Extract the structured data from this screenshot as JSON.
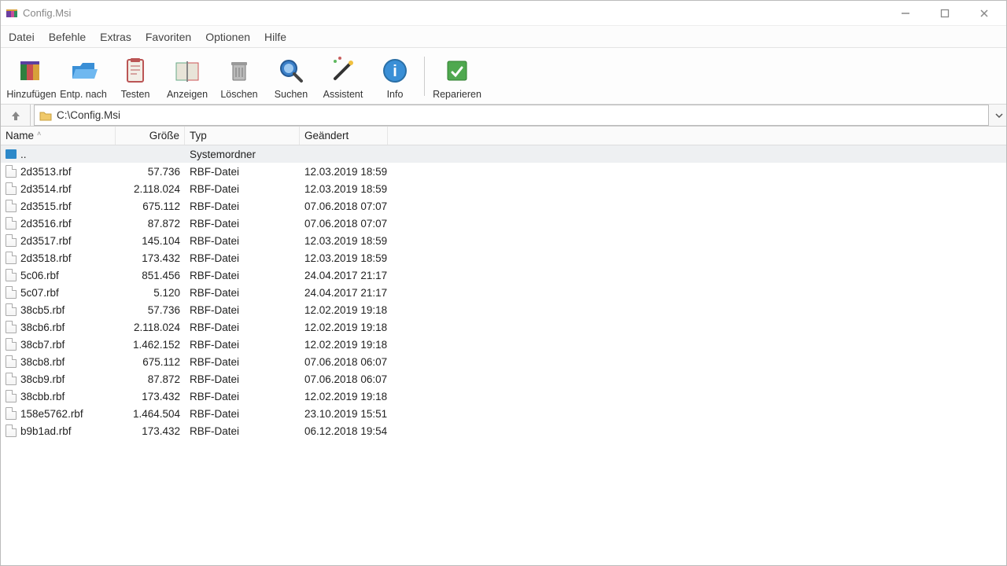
{
  "window": {
    "title": "Config.Msi"
  },
  "menu": {
    "items": [
      "Datei",
      "Befehle",
      "Extras",
      "Favoriten",
      "Optionen",
      "Hilfe"
    ]
  },
  "toolbar": {
    "items": [
      {
        "label": "Hinzufügen",
        "icon": "add"
      },
      {
        "label": "Entp. nach",
        "icon": "extract"
      },
      {
        "label": "Testen",
        "icon": "test"
      },
      {
        "label": "Anzeigen",
        "icon": "view"
      },
      {
        "label": "Löschen",
        "icon": "delete"
      },
      {
        "label": "Suchen",
        "icon": "search"
      },
      {
        "label": "Assistent",
        "icon": "wizard"
      },
      {
        "label": "Info",
        "icon": "info"
      }
    ],
    "after_sep": [
      {
        "label": "Reparieren",
        "icon": "repair"
      }
    ]
  },
  "path": "C:\\Config.Msi",
  "columns": {
    "name": "Name",
    "size": "Größe",
    "type": "Typ",
    "modified": "Geändert"
  },
  "updir": {
    "name": "..",
    "type": "Systemordner"
  },
  "files": [
    {
      "name": "2d3513.rbf",
      "size": "57.736",
      "type": "RBF-Datei",
      "mod": "12.03.2019 18:59"
    },
    {
      "name": "2d3514.rbf",
      "size": "2.118.024",
      "type": "RBF-Datei",
      "mod": "12.03.2019 18:59"
    },
    {
      "name": "2d3515.rbf",
      "size": "675.112",
      "type": "RBF-Datei",
      "mod": "07.06.2018 07:07"
    },
    {
      "name": "2d3516.rbf",
      "size": "87.872",
      "type": "RBF-Datei",
      "mod": "07.06.2018 07:07"
    },
    {
      "name": "2d3517.rbf",
      "size": "145.104",
      "type": "RBF-Datei",
      "mod": "12.03.2019 18:59"
    },
    {
      "name": "2d3518.rbf",
      "size": "173.432",
      "type": "RBF-Datei",
      "mod": "12.03.2019 18:59"
    },
    {
      "name": "5c06.rbf",
      "size": "851.456",
      "type": "RBF-Datei",
      "mod": "24.04.2017 21:17"
    },
    {
      "name": "5c07.rbf",
      "size": "5.120",
      "type": "RBF-Datei",
      "mod": "24.04.2017 21:17"
    },
    {
      "name": "38cb5.rbf",
      "size": "57.736",
      "type": "RBF-Datei",
      "mod": "12.02.2019 19:18"
    },
    {
      "name": "38cb6.rbf",
      "size": "2.118.024",
      "type": "RBF-Datei",
      "mod": "12.02.2019 19:18"
    },
    {
      "name": "38cb7.rbf",
      "size": "1.462.152",
      "type": "RBF-Datei",
      "mod": "12.02.2019 19:18"
    },
    {
      "name": "38cb8.rbf",
      "size": "675.112",
      "type": "RBF-Datei",
      "mod": "07.06.2018 06:07"
    },
    {
      "name": "38cb9.rbf",
      "size": "87.872",
      "type": "RBF-Datei",
      "mod": "07.06.2018 06:07"
    },
    {
      "name": "38cbb.rbf",
      "size": "173.432",
      "type": "RBF-Datei",
      "mod": "12.02.2019 19:18"
    },
    {
      "name": "158e5762.rbf",
      "size": "1.464.504",
      "type": "RBF-Datei",
      "mod": "23.10.2019 15:51"
    },
    {
      "name": "b9b1ad.rbf",
      "size": "173.432",
      "type": "RBF-Datei",
      "mod": "06.12.2018 19:54"
    }
  ]
}
